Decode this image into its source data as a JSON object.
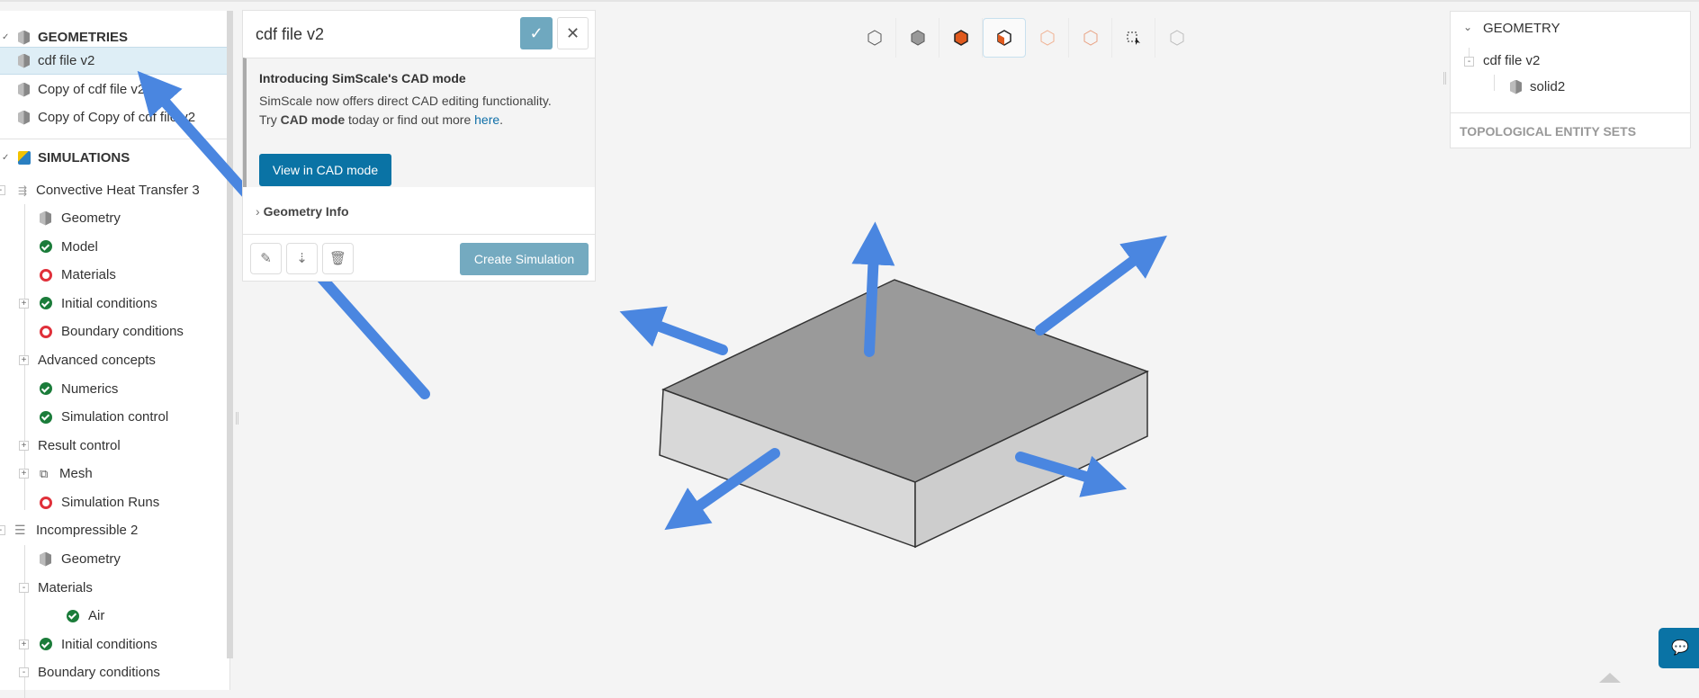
{
  "sidebar": {
    "geometries_header": "GEOMETRIES",
    "geometries": [
      "cdf file v2",
      "Copy of cdf file v2",
      "Copy of Copy of cdf file v2"
    ],
    "simulations_header": "SIMULATIONS",
    "sim1": {
      "name": "Convective Heat Transfer 3",
      "items": [
        {
          "label": "Geometry",
          "status": "geometry-ok"
        },
        {
          "label": "Model",
          "status": "ok"
        },
        {
          "label": "Materials",
          "status": "error"
        },
        {
          "label": "Initial conditions",
          "status": "ok"
        },
        {
          "label": "Boundary conditions",
          "status": "error"
        },
        {
          "label": "Advanced concepts",
          "status": "none"
        },
        {
          "label": "Numerics",
          "status": "ok"
        },
        {
          "label": "Simulation control",
          "status": "ok"
        },
        {
          "label": "Result control",
          "status": "none"
        },
        {
          "label": "Mesh",
          "status": "mesh"
        },
        {
          "label": "Simulation Runs",
          "status": "error"
        }
      ]
    },
    "sim2": {
      "name": "Incompressible 2",
      "items": [
        {
          "label": "Geometry",
          "status": "geometry-ok"
        },
        {
          "label": "Materials",
          "status": "none"
        },
        {
          "label": "Air",
          "status": "ok"
        },
        {
          "label": "Initial conditions",
          "status": "ok"
        },
        {
          "label": "Boundary conditions",
          "status": "none"
        }
      ]
    }
  },
  "dialog": {
    "title": "cdf file v2",
    "promo_title": "Introducing SimScale's CAD mode",
    "promo_line1": "SimScale now offers direct CAD editing functionality.",
    "promo_try": "Try ",
    "promo_bold": "CAD mode",
    "promo_rest": " today or find out more ",
    "promo_link": "here",
    "promo_end": ".",
    "cad_button": "View in CAD mode",
    "geometry_info": "Geometry Info",
    "create_button": "Create Simulation"
  },
  "right_panel": {
    "header": "GEOMETRY",
    "file": "cdf file v2",
    "solid": "solid2",
    "topo": "TOPOLOGICAL ENTITY SETS"
  },
  "colors": {
    "accent": "#0a73a5",
    "arrow": "#4a86e0",
    "ok": "#1b7c3a",
    "error": "#e0303a",
    "orange": "#e05a1e"
  }
}
